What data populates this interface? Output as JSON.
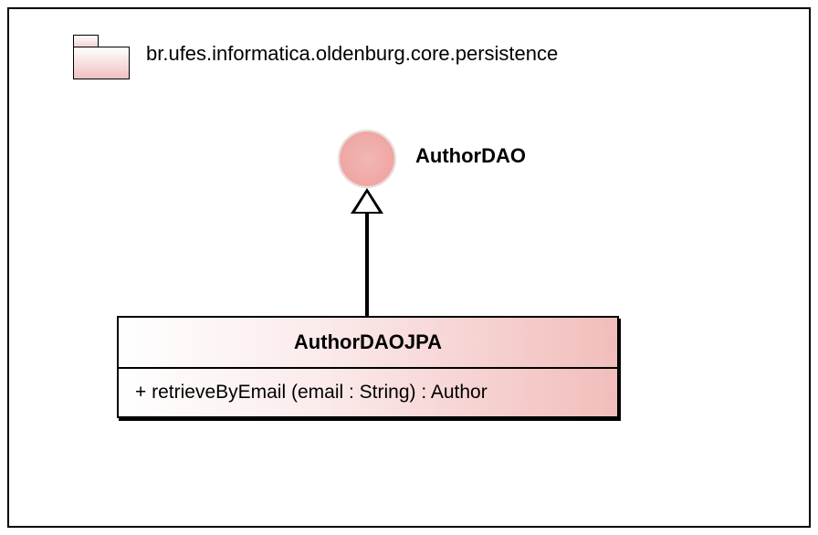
{
  "package": {
    "name": "br.ufes.informatica.oldenburg.core.persistence"
  },
  "interface": {
    "name": "AuthorDAO"
  },
  "class": {
    "name": "AuthorDAOJPA",
    "operations": [
      "+ retrieveByEmail (email : String) : Author"
    ]
  }
}
